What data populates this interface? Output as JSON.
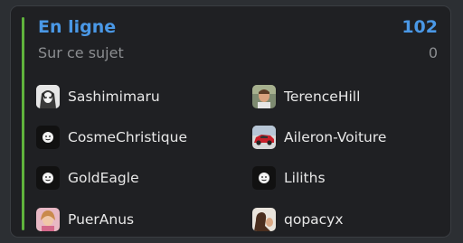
{
  "header": {
    "title": "En ligne",
    "count": "102"
  },
  "subheader": {
    "label": "Sur ce sujet",
    "count": "0"
  },
  "users": [
    {
      "name": "Sashimimaru",
      "avatar": "manga-portrait"
    },
    {
      "name": "TerenceHill",
      "avatar": "photo-portrait"
    },
    {
      "name": "CosmeChristique",
      "avatar": "default-face"
    },
    {
      "name": "Aileron-Voiture",
      "avatar": "red-car"
    },
    {
      "name": "GoldEagle",
      "avatar": "default-face"
    },
    {
      "name": "Liliths",
      "avatar": "default-face"
    },
    {
      "name": "PuerAnus",
      "avatar": "photo-portrait"
    },
    {
      "name": "qopacyx",
      "avatar": "photo-portrait"
    }
  ],
  "colors": {
    "accent": "#4a98e6",
    "bar": "#5fb33c",
    "panel": "#1f2023",
    "text": "#e8e8e8",
    "muted": "#8c8e91"
  }
}
